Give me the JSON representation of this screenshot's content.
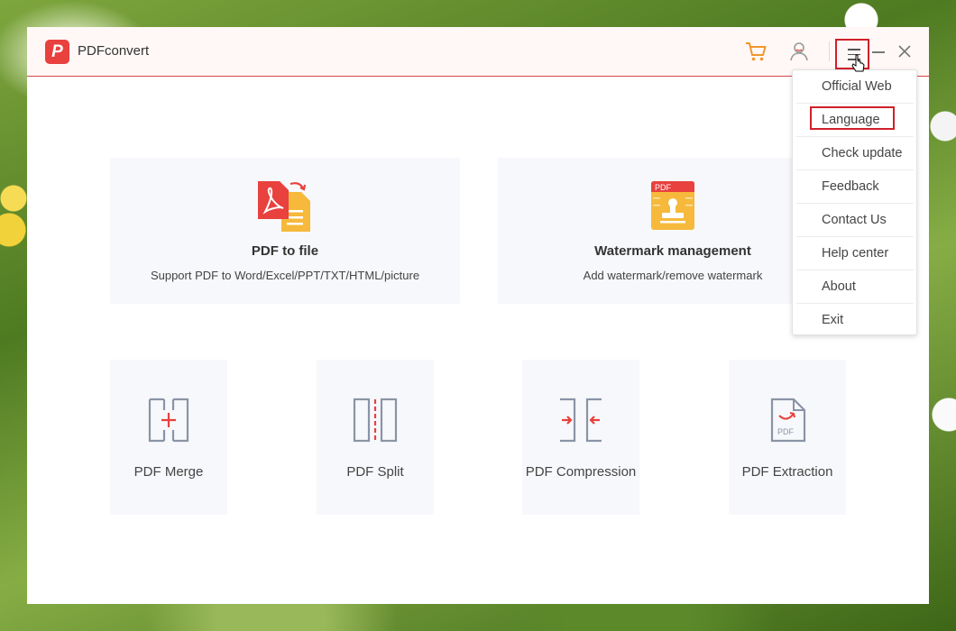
{
  "app": {
    "title": "PDFconvert",
    "logo_letter": "P"
  },
  "titlebar": {
    "icons": [
      "cart-icon",
      "user-icon",
      "menu-icon",
      "minimize-icon",
      "close-icon"
    ]
  },
  "feature_cards": [
    {
      "title": "PDF to file",
      "description": "Support PDF to Word/Excel/PPT/TXT/HTML/picture",
      "icon": "pdf-to-file-icon"
    },
    {
      "title": "Watermark management",
      "description": "Add watermark/remove watermark",
      "icon": "watermark-icon",
      "icon_text": "PDF"
    }
  ],
  "tool_cards": [
    {
      "label": "PDF Merge",
      "icon": "merge-icon"
    },
    {
      "label": "PDF Split",
      "icon": "split-icon"
    },
    {
      "label": "PDF Compression",
      "icon": "compress-icon"
    },
    {
      "label": "PDF Extraction",
      "icon": "extract-icon",
      "icon_text": "PDF"
    }
  ],
  "menu": {
    "items": [
      "Official Web",
      "Language",
      "Check update",
      "Feedback",
      "Contact Us",
      "Help center",
      "About",
      "Exit"
    ],
    "highlighted": "Language"
  },
  "colors": {
    "accent": "#e8413e",
    "highlight_border": "#d0202a",
    "cart": "#f0962e",
    "card_bg": "#f7f8fb"
  }
}
